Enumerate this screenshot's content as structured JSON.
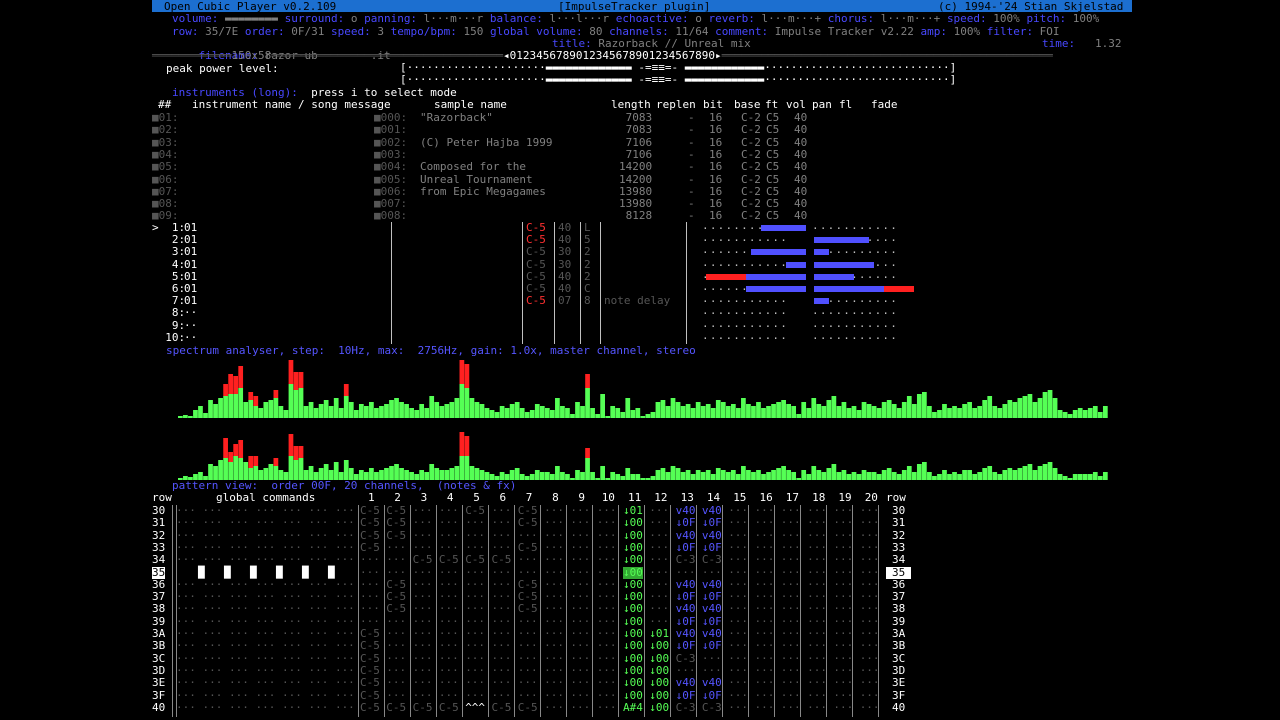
{
  "app": {
    "title_left": "Open Cubic Player v0.2.109",
    "title_center": "[ImpulseTracker plugin]",
    "title_right": "(c) 1994-'24 Stian Skjelstad"
  },
  "status": {
    "row1": [
      {
        "label": "volume:",
        "value": "▬▬▬▬▬▬▬▬"
      },
      {
        "label": "surround:",
        "value": "o"
      },
      {
        "label": "panning:",
        "value": "l···m···r"
      },
      {
        "label": "balance:",
        "value": "l···l···r"
      },
      {
        "label": "echoactive:",
        "value": "o"
      },
      {
        "label": "reverb:",
        "value": "l···m···+"
      },
      {
        "label": "chorus:",
        "value": "l···m···+"
      },
      {
        "label": "speed:",
        "value": "100%"
      },
      {
        "label": "pitch:",
        "value": "100%"
      }
    ],
    "row2": [
      {
        "label": "row:",
        "value": "35/7E"
      },
      {
        "label": "order:",
        "value": "0F/31"
      },
      {
        "label": "speed:",
        "value": "3"
      },
      {
        "label": "tempo/bpm:",
        "value": "150"
      },
      {
        "label": "global volume:",
        "value": "80"
      },
      {
        "label": "channels:",
        "value": "11/64"
      },
      {
        "label": "comment:",
        "value": "Impulse Tracker v2.22"
      },
      {
        "label": "amp:",
        "value": "100%"
      },
      {
        "label": "filter:",
        "value": "FOI"
      }
    ],
    "filename_label": "filename:",
    "filename": "razor-ub",
    "fileext": ".it",
    "title_label": "title:",
    "title": "Razorback // Unreal mix",
    "time_label": "time:",
    "time": "1.32",
    "size": "150x58",
    "ruler": "◂0123456789012345678901234567890▸"
  },
  "peak": {
    "label": "peak power level:",
    "line1": "[·····················▬▬▬▬▬▬▬▬▬▬▬▬▬ -=≡≡=- ▬▬▬▬▬▬▬▬▬▬▬▬····························]",
    "line2": "[·····················▬▬▬▬▬▬▬▬▬▬▬▬▬ -=≡≡=- ▬▬▬▬▬▬▬▬▬▬▬▬····························]"
  },
  "instruments": {
    "heading": "instruments (long):",
    "hint": "press i to select mode",
    "columns": [
      "##",
      "instrument name / song message",
      "sample name",
      "length",
      "replen",
      "bit",
      "base",
      "ft",
      "vol",
      "pan",
      "fl",
      "fade"
    ],
    "rows": [
      {
        "num": "01:",
        "sample": "000:",
        "name": "\"Razorback\"",
        "length": "7083",
        "replen": "-",
        "bit": "16",
        "base": "C-2",
        "ft": "C5",
        "vol": "40"
      },
      {
        "num": "02:",
        "sample": "001:",
        "name": "",
        "length": "7083",
        "replen": "-",
        "bit": "16",
        "base": "C-2",
        "ft": "C5",
        "vol": "40"
      },
      {
        "num": "03:",
        "sample": "002:",
        "name": "(C) Peter Hajba 1999",
        "length": "7106",
        "replen": "-",
        "bit": "16",
        "base": "C-2",
        "ft": "C5",
        "vol": "40"
      },
      {
        "num": "04:",
        "sample": "003:",
        "name": "",
        "length": "7106",
        "replen": "-",
        "bit": "16",
        "base": "C-2",
        "ft": "C5",
        "vol": "40"
      },
      {
        "num": "05:",
        "sample": "004:",
        "name": "Composed for the",
        "length": "14200",
        "replen": "-",
        "bit": "16",
        "base": "C-2",
        "ft": "C5",
        "vol": "40"
      },
      {
        "num": "06:",
        "sample": "005:",
        "name": "Unreal Tournament",
        "length": "14200",
        "replen": "-",
        "bit": "16",
        "base": "C-2",
        "ft": "C5",
        "vol": "40"
      },
      {
        "num": "07:",
        "sample": "006:",
        "name": "from Epic Megagames",
        "length": "13980",
        "replen": "-",
        "bit": "16",
        "base": "C-2",
        "ft": "C5",
        "vol": "40"
      },
      {
        "num": "08:",
        "sample": "007:",
        "name": "",
        "length": "13980",
        "replen": "-",
        "bit": "16",
        "base": "C-2",
        "ft": "C5",
        "vol": "40"
      },
      {
        "num": "09:",
        "sample": "008:",
        "name": "",
        "length": "8128",
        "replen": "-",
        "bit": "16",
        "base": "C-2",
        "ft": "C5",
        "vol": "40"
      }
    ]
  },
  "channels": {
    "rows": [
      {
        "n": ">  1:",
        "ins": "01",
        "note": "C-5",
        "vol": "40",
        "pan": "L",
        "fx": ""
      },
      {
        "n": "   2:",
        "ins": "01",
        "note": "C-5",
        "vol": "40",
        "pan": "5",
        "fx": ""
      },
      {
        "n": "   3:",
        "ins": "01",
        "note": "C-5",
        "vol": "30",
        "pan": "2",
        "fx": ""
      },
      {
        "n": "   4:",
        "ins": "01",
        "note": "C-5",
        "vol": "30",
        "pan": "2",
        "fx": ""
      },
      {
        "n": "   5:",
        "ins": "01",
        "note": "C-5",
        "vol": "40",
        "pan": "2",
        "fx": ""
      },
      {
        "n": "   6:",
        "ins": "01",
        "note": "C-5",
        "vol": "40",
        "pan": "C",
        "fx": ""
      },
      {
        "n": "   7:",
        "ins": "01",
        "note": "C-5",
        "vol": "07",
        "pan": "8",
        "fx": "note delay"
      },
      {
        "n": "   8:",
        "ins": "··",
        "note": "",
        "vol": "",
        "pan": "",
        "fx": ""
      },
      {
        "n": "   9:",
        "ins": "··",
        "note": "",
        "vol": "",
        "pan": "",
        "fx": ""
      },
      {
        "n": "  10:",
        "ins": "··",
        "note": "",
        "vol": "",
        "pan": "",
        "fx": ""
      }
    ],
    "levels_left": [
      0.45,
      0,
      0.55,
      0.2,
      1.0,
      0.6,
      0,
      0,
      0,
      0
    ],
    "levels_right": [
      0,
      0.55,
      0.15,
      0.6,
      0.4,
      1.0,
      0.15,
      0,
      0,
      0
    ]
  },
  "spectrum": {
    "heading": "spectrum analyser, step:  10Hz, max:  2756Hz, gain: 1.0x, master channel, stereo",
    "top": [
      2,
      3,
      2,
      8,
      12,
      5,
      18,
      14,
      20,
      22,
      24,
      24,
      30,
      16,
      18,
      12,
      10,
      16,
      18,
      20,
      12,
      8,
      34,
      28,
      30,
      12,
      16,
      10,
      14,
      18,
      12,
      20,
      10,
      22,
      16,
      8,
      14,
      12,
      16,
      10,
      12,
      14,
      18,
      20,
      16,
      14,
      10,
      8,
      14,
      10,
      22,
      16,
      12,
      14,
      16,
      20,
      34,
      30,
      20,
      16,
      14,
      10,
      8,
      6,
      12,
      10,
      14,
      16,
      10,
      6,
      8,
      14,
      12,
      10,
      8,
      20,
      12,
      10,
      4,
      16,
      12,
      30,
      10,
      4,
      24,
      2,
      12,
      10,
      6,
      20,
      8,
      10,
      2,
      4,
      6,
      16,
      18,
      12,
      20,
      16,
      12,
      14,
      10,
      16,
      12,
      14,
      10,
      18,
      16,
      12,
      14,
      10,
      20,
      14,
      12,
      16,
      10,
      12,
      14,
      16,
      18,
      14,
      12,
      4,
      16,
      10,
      20,
      14,
      12,
      18,
      22,
      12,
      16,
      10,
      12,
      8,
      16,
      14,
      12,
      10,
      16,
      18,
      14,
      10,
      16,
      22,
      14,
      24,
      26,
      12,
      6,
      8,
      14,
      10,
      12,
      10,
      14,
      16,
      10,
      12,
      18,
      22,
      12,
      10,
      14,
      18,
      16,
      20,
      22,
      24,
      16,
      20,
      26,
      28,
      20,
      8,
      6,
      4,
      8,
      10,
      8,
      10,
      12,
      6,
      12
    ],
    "top_red": [
      0,
      0,
      0,
      0,
      0,
      0,
      0,
      0,
      0,
      12,
      20,
      18,
      22,
      0,
      8,
      10,
      0,
      0,
      0,
      8,
      0,
      0,
      24,
      18,
      16,
      0,
      0,
      0,
      0,
      0,
      0,
      0,
      0,
      12,
      0,
      0,
      0,
      0,
      0,
      0,
      0,
      0,
      0,
      0,
      0,
      0,
      0,
      0,
      0,
      0,
      0,
      0,
      0,
      0,
      0,
      0,
      24,
      24,
      0,
      0,
      0,
      0,
      0,
      0,
      0,
      0,
      0,
      0,
      0,
      0,
      0,
      0,
      0,
      0,
      0,
      0,
      0,
      0,
      0,
      0,
      0,
      14,
      0,
      0,
      0,
      0,
      0,
      0,
      0,
      0,
      0,
      0,
      0,
      0,
      0,
      0,
      0,
      0,
      0,
      0,
      0,
      0,
      0,
      0,
      0,
      0,
      0,
      0,
      0,
      0,
      0,
      0,
      0,
      0,
      0,
      0,
      0,
      0,
      0,
      0,
      0,
      0,
      0,
      0,
      0,
      0,
      0,
      0,
      0,
      0,
      0,
      0,
      0,
      0,
      0,
      0,
      0,
      0,
      0,
      0,
      0,
      0,
      0,
      0,
      0,
      0,
      0,
      0,
      0,
      0,
      0,
      0,
      0,
      0,
      0,
      0,
      0,
      0,
      0,
      0,
      0,
      0,
      0,
      0,
      0,
      0,
      0,
      0,
      0,
      0,
      0,
      0,
      0,
      0,
      0,
      0,
      0,
      0,
      0,
      0,
      0,
      0,
      0,
      0,
      0,
      0
    ],
    "bottom": [
      2,
      4,
      3,
      6,
      8,
      4,
      16,
      14,
      20,
      22,
      18,
      24,
      22,
      18,
      12,
      14,
      10,
      12,
      16,
      14,
      10,
      8,
      24,
      20,
      22,
      10,
      14,
      8,
      12,
      16,
      10,
      18,
      8,
      20,
      12,
      6,
      10,
      8,
      12,
      8,
      10,
      12,
      14,
      16,
      12,
      10,
      8,
      6,
      10,
      8,
      16,
      12,
      10,
      10,
      12,
      14,
      24,
      24,
      14,
      12,
      10,
      8,
      6,
      4,
      8,
      6,
      10,
      12,
      6,
      4,
      6,
      10,
      8,
      8,
      6,
      14,
      8,
      6,
      2,
      10,
      8,
      22,
      8,
      2,
      14,
      2,
      8,
      6,
      4,
      12,
      6,
      6,
      2,
      2,
      4,
      10,
      12,
      8,
      14,
      12,
      8,
      10,
      6,
      10,
      8,
      10,
      6,
      12,
      10,
      8,
      10,
      6,
      14,
      10,
      8,
      10,
      6,
      8,
      10,
      12,
      14,
      10,
      8,
      2,
      10,
      6,
      14,
      10,
      8,
      12,
      16,
      8,
      10,
      6,
      8,
      6,
      10,
      8,
      8,
      6,
      10,
      12,
      8,
      6,
      10,
      14,
      8,
      16,
      18,
      8,
      4,
      6,
      10,
      6,
      8,
      6,
      10,
      10,
      6,
      8,
      12,
      14,
      8,
      6,
      10,
      12,
      10,
      12,
      14,
      16,
      10,
      14,
      16,
      18,
      12,
      6,
      4,
      2,
      6,
      6,
      6,
      6,
      8,
      4,
      8
    ],
    "bottom_red": [
      0,
      0,
      0,
      0,
      0,
      0,
      0,
      0,
      0,
      20,
      10,
      12,
      18,
      0,
      12,
      10,
      0,
      0,
      0,
      8,
      0,
      0,
      22,
      14,
      12,
      0,
      0,
      0,
      0,
      0,
      0,
      0,
      0,
      0,
      0,
      0,
      0,
      0,
      0,
      0,
      0,
      0,
      0,
      0,
      0,
      0,
      0,
      0,
      0,
      0,
      0,
      0,
      0,
      0,
      0,
      0,
      24,
      20,
      0,
      0,
      0,
      0,
      0,
      0,
      0,
      0,
      0,
      0,
      0,
      0,
      0,
      0,
      0,
      0,
      0,
      0,
      0,
      0,
      0,
      0,
      0,
      10,
      0,
      0,
      0,
      0,
      0,
      0,
      0,
      0,
      0,
      0,
      0,
      0,
      0,
      0,
      0,
      0,
      0,
      0,
      0,
      0,
      0,
      0,
      0,
      0,
      0,
      0,
      0,
      0,
      0,
      0,
      0,
      0,
      0,
      0,
      0,
      0,
      0,
      0,
      0,
      0,
      0,
      0,
      0,
      0,
      0,
      0,
      0,
      0,
      0,
      0,
      0,
      0,
      0,
      0,
      0,
      0,
      0,
      0,
      0,
      0,
      0,
      0,
      0,
      0,
      0,
      0,
      0,
      0,
      0,
      0,
      0,
      0,
      0,
      0,
      0,
      0,
      0,
      0,
      0,
      0,
      0,
      0,
      0,
      0,
      0,
      0,
      0,
      0,
      0,
      0,
      0,
      0,
      0,
      0,
      0,
      0,
      0,
      0,
      0,
      0,
      0,
      0,
      0,
      0
    ]
  },
  "pattern": {
    "heading": "pattern view:  order 00F, 20 channels,  (notes & fx)",
    "row_label": "row",
    "global_label": "global commands",
    "channel_numbers": [
      "1",
      "2",
      "3",
      "4",
      "5",
      "6",
      "7",
      "8",
      "9",
      "10",
      "11",
      "12",
      "13",
      "14",
      "15",
      "16",
      "17",
      "18",
      "19",
      "20"
    ],
    "rows": [
      "30",
      "31",
      "32",
      "33",
      "34",
      "35",
      "36",
      "37",
      "38",
      "39",
      "3A",
      "3B",
      "3C",
      "3D",
      "3E",
      "3F",
      "40"
    ],
    "current_row": "35",
    "col11": [
      "↓01",
      "↓00",
      "↓00",
      "↓00",
      "↓00",
      "",
      "↓00",
      "↓00",
      "↓00",
      "↓00",
      "↓00",
      "↓00",
      "↓00",
      "↓00",
      "↓00",
      "↓00",
      "A#4"
    ],
    "col12": [
      "",
      "",
      "",
      "",
      "",
      "",
      "",
      "",
      "",
      "",
      "↓01",
      "↓00",
      "↓00",
      "↓00",
      "↓00",
      "↓00",
      "↓00"
    ],
    "col13": [
      "v40",
      "↓0F",
      "v40",
      "↓0F",
      "C-3",
      "",
      "v40",
      "↓0F",
      "v40",
      "↓0F",
      "v40",
      "↓0F",
      "C-3",
      "",
      "v40",
      "↓0F",
      "C-3"
    ],
    "col14": [
      "v40",
      "↓0F",
      "v40",
      "↓0F",
      "C-3",
      "",
      "v40",
      "↓0F",
      "v40",
      "↓0F",
      "v40",
      "↓0F",
      "",
      "",
      "v40",
      "↓0F",
      "C-3"
    ],
    "col1": [
      "C-5",
      "C-5",
      "C-5",
      "C-5",
      "",
      "",
      "",
      "",
      "",
      "",
      "C-5",
      "C-5",
      "C-5",
      "C-5",
      "C-5",
      "C-5",
      "C-5"
    ],
    "col2": [
      "C-5",
      "C-5",
      "C-5",
      "",
      "",
      "",
      "C-5",
      "C-5",
      "C-5",
      "",
      "",
      "",
      "",
      "",
      "",
      "",
      "C-5"
    ],
    "col7": [
      "C-5",
      "C-5",
      "",
      "C-5",
      "",
      "",
      "C-5",
      "C-5",
      "C-5",
      "",
      "",
      "",
      "",
      "",
      "",
      "",
      "C-5"
    ],
    "col3": [
      "",
      "",
      "",
      "",
      "C-5",
      "",
      "",
      "",
      "",
      "",
      "",
      "",
      "",
      "",
      "",
      "",
      "C-5"
    ],
    "col4": [
      "",
      "",
      "",
      "",
      "C-5",
      "",
      "",
      "",
      "",
      "",
      "",
      "",
      "",
      "",
      "",
      "",
      "C-5"
    ],
    "col5": [
      "C-5",
      "",
      "",
      "",
      "C-5",
      "",
      "",
      "",
      "",
      "",
      "",
      "",
      "",
      "",
      "",
      "",
      "^^^"
    ],
    "col6": [
      "",
      "",
      "",
      "",
      "C-5",
      "",
      "",
      "",
      "",
      "",
      "",
      "",
      "",
      "",
      "",
      "",
      "C-5"
    ]
  }
}
